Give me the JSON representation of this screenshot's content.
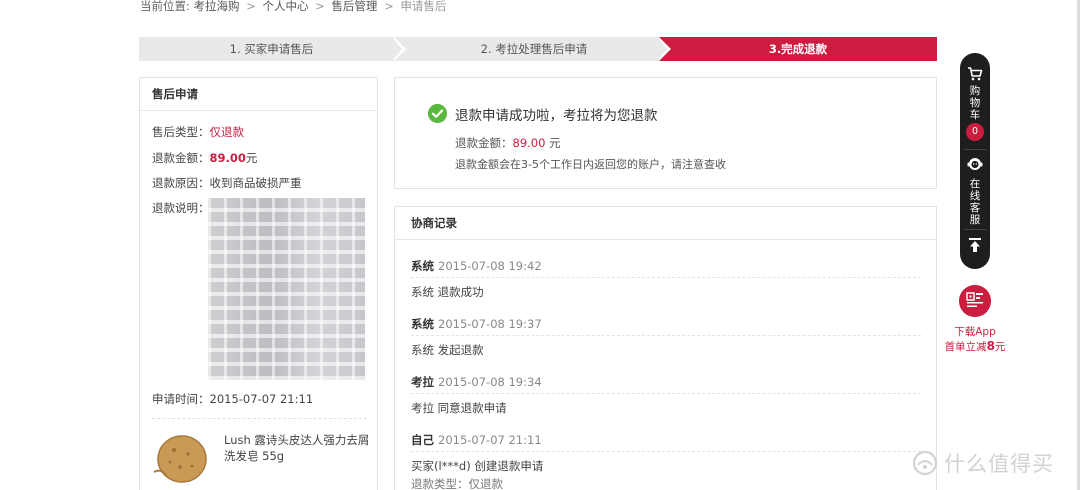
{
  "breadcrumb": {
    "label": "当前位置:",
    "items": [
      "考拉海购",
      "个人中心",
      "售后管理",
      "申请售后"
    ],
    "separator": ">"
  },
  "steps": [
    "1. 买家申请售后",
    "2. 考拉处理售后申请",
    "3.完成退款"
  ],
  "colors": {
    "accent": "#cc1c40",
    "success": "#5ab83f",
    "sidebar": "#1e1e1e"
  },
  "after_sale": {
    "title": "售后申请",
    "type_label": "售后类型：",
    "type_value": "仅退款",
    "amount_label": "退款金额：",
    "amount_value": "89.00",
    "amount_unit": "元",
    "reason_label": "退款原因：",
    "reason_value": "收到商品破损严重",
    "desc_label": "退款说明：",
    "time_label": "申请时间：",
    "time_value": "2015-07-07 21:11",
    "product_name": "Lush 露诗头皮达人强力去屑洗发皂 55g"
  },
  "success": {
    "title": "退款申请成功啦，考拉将为您退款",
    "amount_label": "退款金额：",
    "amount_value": "89.00",
    "amount_unit": " 元",
    "note": "退款金额会在3-5个工作日内返回您的账户，请注意查收"
  },
  "log": {
    "title": "协商记录",
    "entries": [
      {
        "who": "系统",
        "time": "2015-07-08 19:42",
        "text": "系统 退款成功"
      },
      {
        "who": "系统",
        "time": "2015-07-08 19:37",
        "text": "系统 发起退款"
      },
      {
        "who": "考拉",
        "time": "2015-07-08 19:34",
        "text": "考拉 同意退款申请"
      },
      {
        "who": "自己",
        "time": "2015-07-07 21:11",
        "text": "买家(l***d) 创建退款申请",
        "sub": "退款类型：仅退款"
      }
    ]
  },
  "sidebar": {
    "cart": "购物车",
    "cart_count": "0",
    "service": "在线客服",
    "icons": [
      "cart-icon",
      "headset-icon",
      "back-to-top-icon",
      "qrcode-icon"
    ]
  },
  "app_promo": {
    "line1": "下载App",
    "line2_prefix": "首单立减",
    "line2_amount": "8",
    "line2_suffix": "元"
  },
  "watermark": "什么值得买"
}
